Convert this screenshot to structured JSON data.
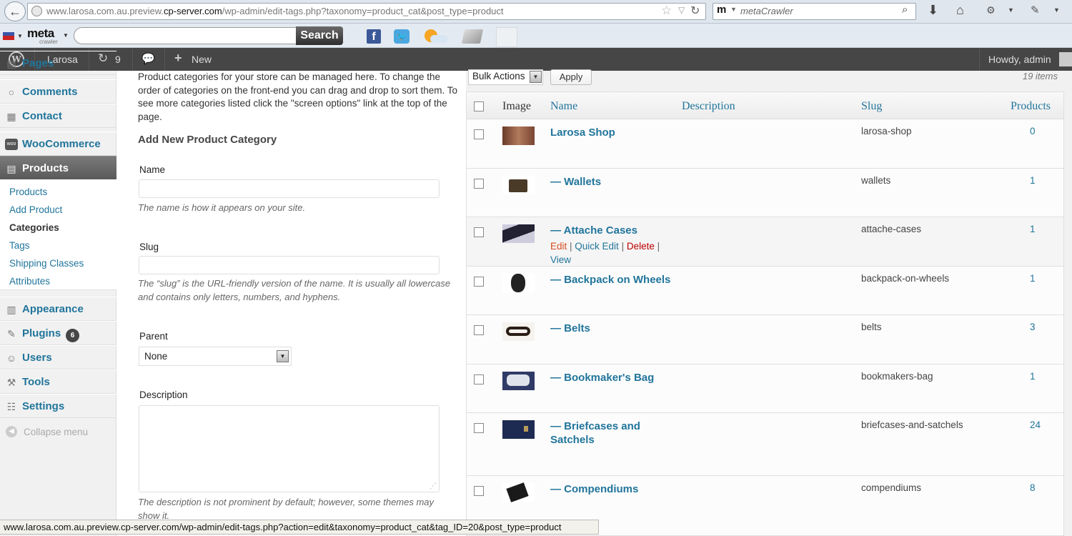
{
  "browser": {
    "url_prefix": "www.larosa.com.au.preview.",
    "url_domain": "cp-server.com",
    "url_suffix": "/wp-admin/edit-tags.php?taxonomy=product_cat&post_type=product",
    "search_engine_placeholder": "metaCrawler",
    "search_engine_logo": "m",
    "toolbar_logo": "meta",
    "toolbar_logo_sub": "crawler",
    "toolbar_search_button": "Search",
    "facebook_glyph": "f",
    "status_url": "www.larosa.com.au.preview.cp-server.com/wp-admin/edit-tags.php?action=edit&taxonomy=product_cat&tag_ID=20&post_type=product"
  },
  "adminbar": {
    "site_name": "Larosa",
    "updates_count": "9",
    "new_label": "New",
    "howdy": "Howdy, admin"
  },
  "menu": {
    "pages_label": "Pages",
    "comments": "Comments",
    "contact": "Contact",
    "woocommerce": "WooCommerce",
    "products": "Products",
    "submenu": [
      "Products",
      "Add Product",
      "Categories",
      "Tags",
      "Shipping Classes",
      "Attributes"
    ],
    "appearance": "Appearance",
    "plugins": "Plugins",
    "plugins_badge": "6",
    "users": "Users",
    "tools": "Tools",
    "settings": "Settings",
    "collapse": "Collapse menu"
  },
  "form": {
    "intro": "Product categories for your store can be managed here. To change the order of categories on the front-end you can drag and drop to sort them. To see more categories listed click the \"screen options\" link at the top of the page.",
    "heading": "Add New Product Category",
    "name_label": "Name",
    "name_value": "",
    "name_help": "The name is how it appears on your site.",
    "slug_label": "Slug",
    "slug_value": "",
    "slug_help": "The “slug” is the URL-friendly version of the name. It is usually all lowercase and contains only letters, numbers, and hyphens.",
    "parent_label": "Parent",
    "parent_value": "None",
    "description_label": "Description",
    "description_value": "",
    "description_help": "The description is not prominent by default; however, some themes may show it."
  },
  "list": {
    "bulk_actions": "Bulk Actions",
    "apply": "Apply",
    "items_count": "19 items",
    "columns": {
      "image": "Image",
      "name": "Name",
      "description": "Description",
      "slug": "Slug",
      "products": "Products"
    },
    "row_actions": {
      "edit": "Edit",
      "quick_edit": "Quick Edit",
      "delete": "Delete",
      "view": "View"
    },
    "rows": [
      {
        "name": "Larosa Shop",
        "slug": "larosa-shop",
        "count": "0"
      },
      {
        "name": "— Wallets",
        "slug": "wallets",
        "count": "1"
      },
      {
        "name": "— Attache Cases",
        "slug": "attache-cases",
        "count": "1"
      },
      {
        "name": "— Backpack on Wheels",
        "slug": "backpack-on-wheels",
        "count": "1"
      },
      {
        "name": "— Belts",
        "slug": "belts",
        "count": "3"
      },
      {
        "name": "— Bookmaker's Bag",
        "slug": "bookmakers-bag",
        "count": "1"
      },
      {
        "name": "— Briefcases and Satchels",
        "slug": "briefcases-and-satchels",
        "count": "24"
      },
      {
        "name": "— Compendiums",
        "slug": "compendiums",
        "count": "8"
      }
    ]
  }
}
